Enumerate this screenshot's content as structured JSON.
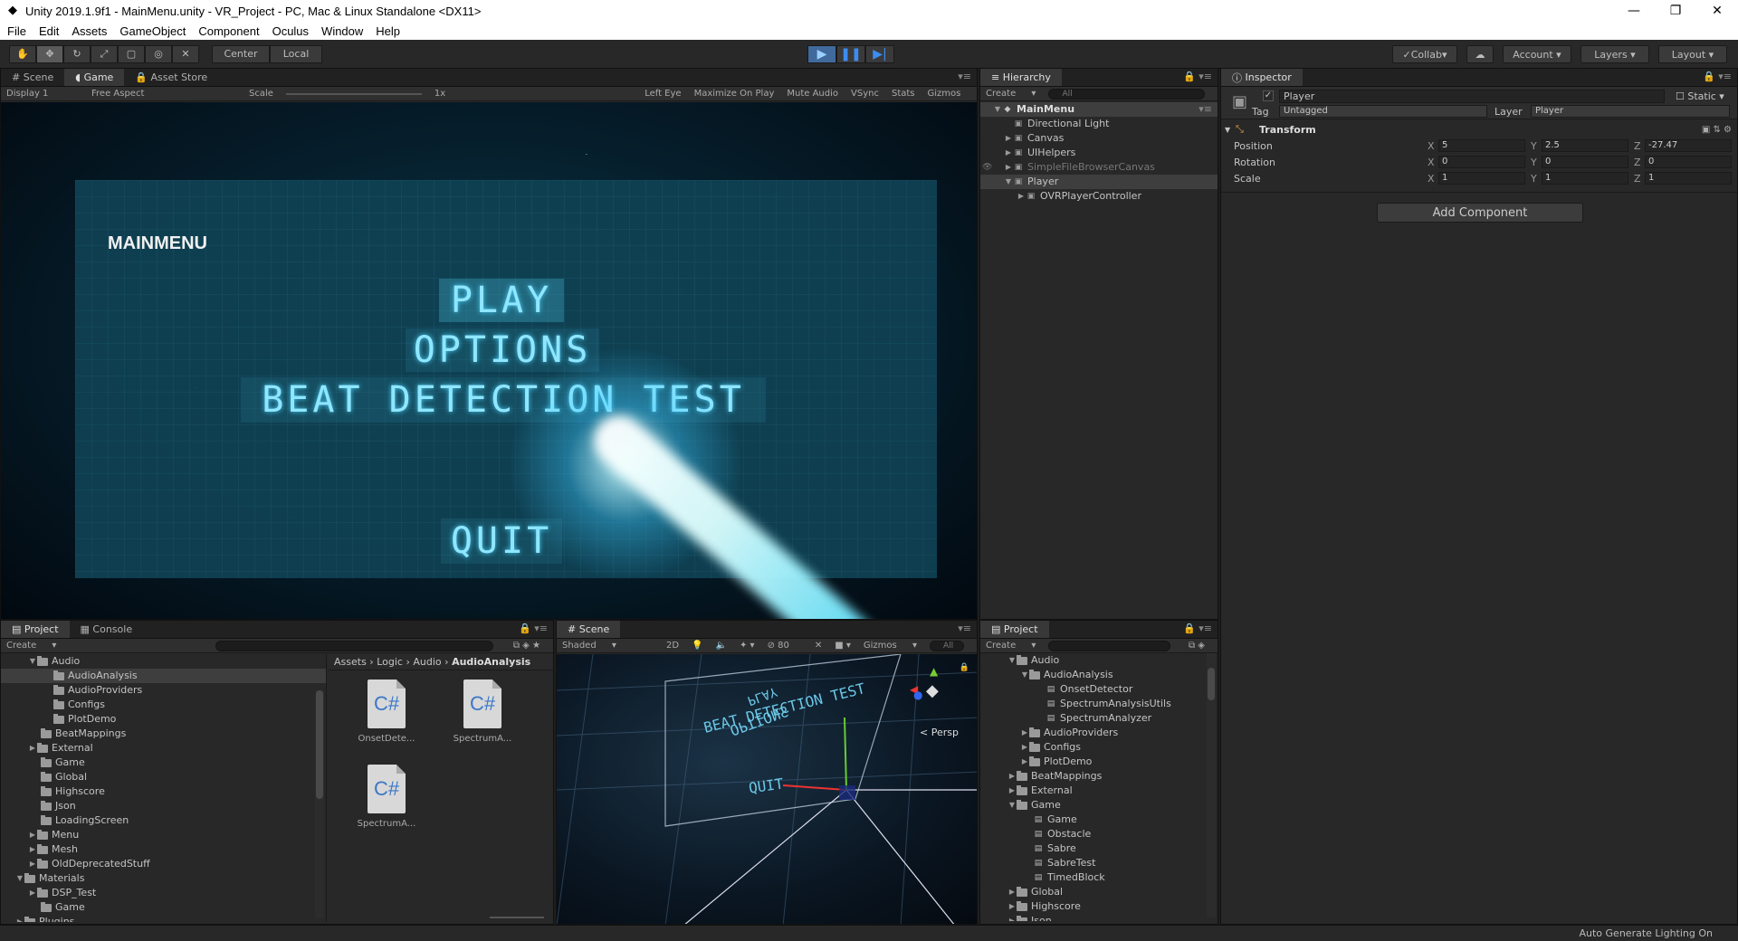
{
  "window": {
    "title": "Unity 2019.1.9f1 - MainMenu.unity - VR_Project - PC, Mac & Linux Standalone <DX11>"
  },
  "menubar": [
    "File",
    "Edit",
    "Assets",
    "GameObject",
    "Component",
    "Oculus",
    "Window",
    "Help"
  ],
  "toolbar": {
    "pivot": "Center",
    "space": "Local",
    "collab": "Collab",
    "account": "Account",
    "layers": "Layers",
    "layout": "Layout"
  },
  "game_panel": {
    "tabs": [
      "Scene",
      "Game",
      "Asset Store"
    ],
    "display": "Display 1",
    "aspect": "Free Aspect",
    "scale_label": "Scale",
    "scale_value": "1x",
    "eye": "Left Eye",
    "maximize": "Maximize On Play",
    "mute": "Mute Audio",
    "vsync": "VSync",
    "stats": "Stats",
    "gizmos": "Gizmos",
    "menu_title": "MAINMENU",
    "buttons": {
      "play": "PLAY",
      "options": "OPTIONS",
      "beat": "BEAT DETECTION TEST",
      "quit": "QUIT"
    }
  },
  "hierarchy": {
    "tab": "Hierarchy",
    "create": "Create",
    "search": "All",
    "scene": "MainMenu",
    "items": [
      "Directional Light",
      "Canvas",
      "UIHelpers",
      "SimpleFileBrowserCanvas",
      "Player",
      "OVRPlayerController"
    ]
  },
  "inspector": {
    "tab": "Inspector",
    "name": "Player",
    "static": "Static",
    "tag_label": "Tag",
    "tag": "Untagged",
    "layer_label": "Layer",
    "layer": "Player",
    "component": "Transform",
    "position": {
      "label": "Position",
      "x": "5",
      "y": "2.5",
      "z": "-27.47"
    },
    "rotation": {
      "label": "Rotation",
      "x": "0",
      "y": "0",
      "z": "0"
    },
    "scale": {
      "label": "Scale",
      "x": "1",
      "y": "1",
      "z": "1"
    },
    "add_component": "Add Component"
  },
  "project_left": {
    "tabs": [
      "Project",
      "Console"
    ],
    "create": "Create",
    "tree": [
      "Audio",
      "AudioAnalysis",
      "AudioProviders",
      "Configs",
      "PlotDemo",
      "BeatMappings",
      "External",
      "Game",
      "Global",
      "Highscore",
      "Json",
      "LoadingScreen",
      "Menu",
      "Mesh",
      "OldDeprecatedStuff",
      "Materials",
      "DSP_Test",
      "Game",
      "Plugins"
    ],
    "breadcrumb": [
      "Assets",
      "Logic",
      "Audio",
      "AudioAnalysis"
    ],
    "files": [
      "OnsetDete...",
      "SpectrumA...",
      "SpectrumA..."
    ],
    "file_icon": "C#"
  },
  "scene_panel": {
    "tab": "Scene",
    "shading": "Shaded",
    "mode2d": "2D",
    "fx_count": "80",
    "gizmos": "Gizmos",
    "search": "All",
    "persp": "< Persp",
    "scene_texts": [
      "PLAY",
      "OPTIONS",
      "BEAT DETECTION TEST",
      "QUIT"
    ]
  },
  "project_right": {
    "tab": "Project",
    "create": "Create",
    "tree": [
      "Audio",
      "AudioAnalysis",
      "OnsetDetector",
      "SpectrumAnalysisUtils",
      "SpectrumAnalyzer",
      "AudioProviders",
      "Configs",
      "PlotDemo",
      "BeatMappings",
      "External",
      "Game",
      "Game",
      "Obstacle",
      "Sabre",
      "SabreTest",
      "TimedBlock",
      "Global",
      "Highscore",
      "Json"
    ]
  },
  "status": "Auto Generate Lighting On"
}
